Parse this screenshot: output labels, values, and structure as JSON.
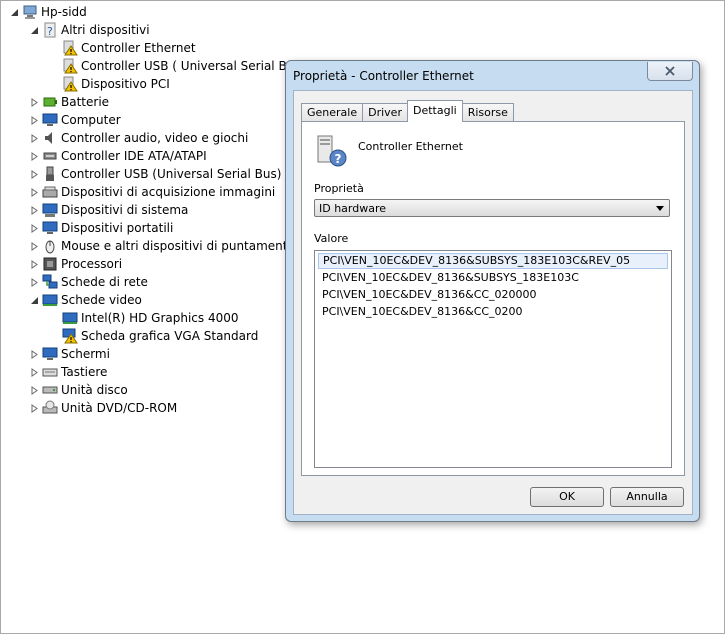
{
  "tree": {
    "root": "Hp-sidd",
    "altri": "Altri dispositivi",
    "altri_children": [
      "Controller Ethernet",
      "Controller USB ( Universal Serial Bus)",
      "Dispositivo PCI"
    ],
    "categories_a": [
      "Batterie",
      "Computer",
      "Controller audio, video e giochi",
      "Controller IDE ATA/ATAPI",
      "Controller USB (Universal Serial Bus)",
      "Dispositivi di acquisizione immagini",
      "Dispositivi di sistema",
      "Dispositivi portatili",
      "Mouse e altri dispositivi di puntamento",
      "Processori",
      "Schede di rete"
    ],
    "schede_video": "Schede video",
    "video_children": [
      "Intel(R) HD Graphics 4000",
      "Scheda grafica VGA Standard"
    ],
    "categories_b": [
      "Schermi",
      "Tastiere",
      "Unità disco",
      "Unità DVD/CD-ROM"
    ]
  },
  "dialog": {
    "title": "Proprietà - Controller Ethernet",
    "tabs": [
      "Generale",
      "Driver",
      "Dettagli",
      "Risorse"
    ],
    "active_tab": "Dettagli",
    "device_name": "Controller Ethernet",
    "property_label": "Proprietà",
    "property_value": "ID hardware",
    "value_label": "Valore",
    "values": [
      "PCI\\VEN_10EC&DEV_8136&SUBSYS_183E103C&REV_05",
      "PCI\\VEN_10EC&DEV_8136&SUBSYS_183E103C",
      "PCI\\VEN_10EC&DEV_8136&CC_020000",
      "PCI\\VEN_10EC&DEV_8136&CC_0200"
    ],
    "ok_label": "OK",
    "cancel_label": "Annulla"
  },
  "colors": {
    "dialog_frame": "#c6dcf1",
    "selection": "#e8f1fb",
    "warning": "#f2c200"
  }
}
